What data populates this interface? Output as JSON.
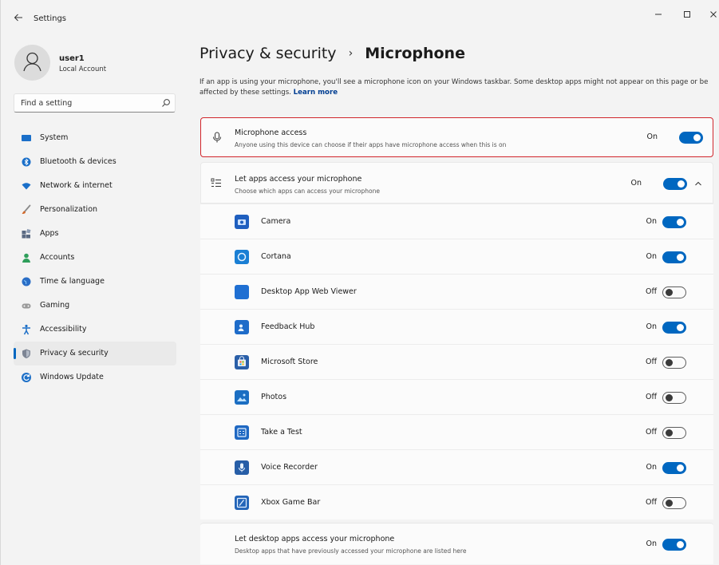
{
  "titlebar": {
    "title": "Settings"
  },
  "profile": {
    "name": "user1",
    "subtitle": "Local Account"
  },
  "search": {
    "placeholder": "Find a setting"
  },
  "nav": [
    {
      "label": "System",
      "icon": "monitor-icon",
      "color": "#0067c0"
    },
    {
      "label": "Bluetooth & devices",
      "icon": "bluetooth-icon",
      "color": "#0067c0"
    },
    {
      "label": "Network & internet",
      "icon": "wifi-icon",
      "color": "#0067c0"
    },
    {
      "label": "Personalization",
      "icon": "brush-icon",
      "color": "#c25d2b"
    },
    {
      "label": "Apps",
      "icon": "apps-icon",
      "color": "#566b86"
    },
    {
      "label": "Accounts",
      "icon": "person-icon",
      "color": "#2e9e5a"
    },
    {
      "label": "Time & language",
      "icon": "globe-clock-icon",
      "color": "#2a6ec6"
    },
    {
      "label": "Gaming",
      "icon": "gamepad-icon",
      "color": "#8a8a8a"
    },
    {
      "label": "Accessibility",
      "icon": "accessibility-icon",
      "color": "#1e70c7"
    },
    {
      "label": "Privacy & security",
      "icon": "shield-icon",
      "color": "#7d8594",
      "active": true
    },
    {
      "label": "Windows Update",
      "icon": "refresh-icon",
      "color": "#1e70c7"
    }
  ],
  "main": {
    "breadcrumb_parent": "Privacy & security",
    "breadcrumb_sep": "›",
    "breadcrumb_current": "Microphone",
    "description": "If an app is using your microphone, you'll see a microphone icon on your Windows taskbar. Some desktop apps might not appear on this page or be affected by these settings.",
    "learn_more": "Learn more",
    "mic_access": {
      "title": "Microphone access",
      "subtitle": "Anyone using this device can choose if their apps have microphone access when this is on",
      "state": "On"
    },
    "apps_access": {
      "title": "Let apps access your microphone",
      "subtitle": "Choose which apps can access your microphone",
      "state": "On"
    },
    "apps": [
      {
        "name": "Camera",
        "state": "On",
        "color": "#1f5fbf"
      },
      {
        "name": "Cortana",
        "state": "On",
        "color": "#1a7fd4"
      },
      {
        "name": "Desktop App Web Viewer",
        "state": "Off",
        "color": "#1f6fd2"
      },
      {
        "name": "Feedback Hub",
        "state": "On",
        "color": "#1e6cc9"
      },
      {
        "name": "Microsoft Store",
        "state": "Off",
        "color": "#2a5fa8"
      },
      {
        "name": "Photos",
        "state": "Off",
        "color": "#1b6ec2"
      },
      {
        "name": "Take a Test",
        "state": "Off",
        "color": "#1f68c2"
      },
      {
        "name": "Voice Recorder",
        "state": "On",
        "color": "#275ea7"
      },
      {
        "name": "Xbox Game Bar",
        "state": "Off",
        "color": "#2465b8"
      }
    ],
    "desktop_access": {
      "title": "Let desktop apps access your microphone",
      "subtitle": "Desktop apps that have previously accessed your microphone are listed here",
      "state": "On"
    }
  }
}
